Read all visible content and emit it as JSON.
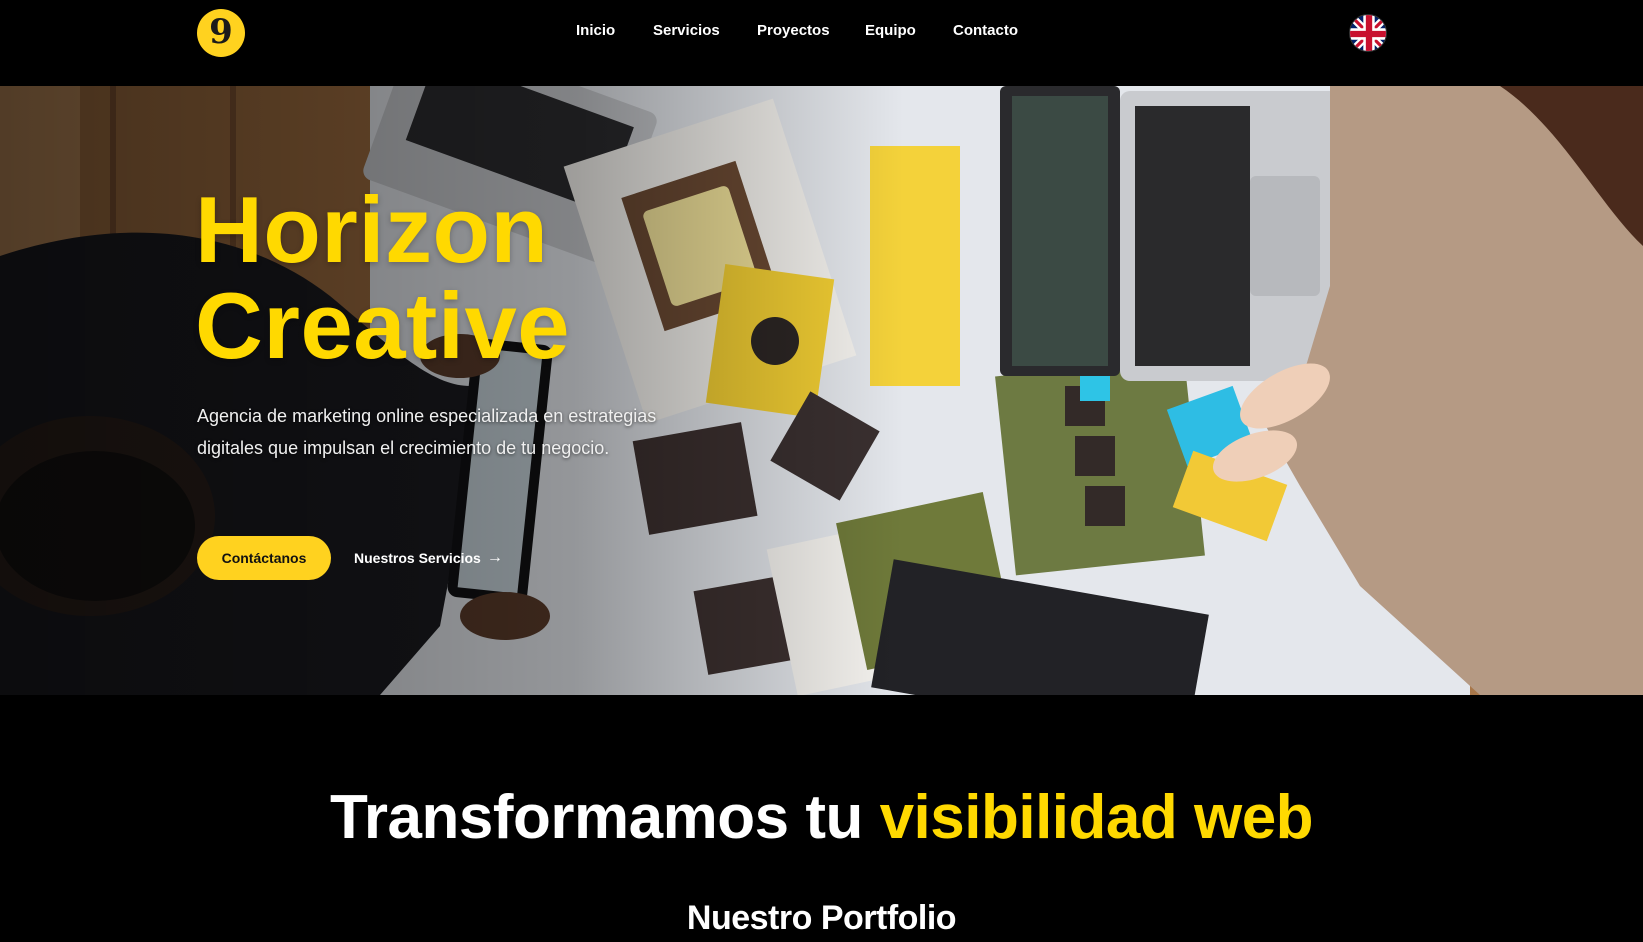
{
  "nav": {
    "logo_icon": "horizon-logo-icon",
    "items": [
      {
        "label": "Inicio"
      },
      {
        "label": "Servicios"
      },
      {
        "label": "Proyectos"
      },
      {
        "label": "Equipo"
      },
      {
        "label": "Contacto"
      }
    ],
    "language_icon": "uk-flag-icon"
  },
  "hero": {
    "title_line1": "Horizon",
    "title_line2": "Creative",
    "subtitle": "Agencia de marketing online especializada en estrategias digitales que impulsan el crecimiento de tu negocio.",
    "primary_button": "Contáctanos",
    "secondary_link": "Nuestros Servicios",
    "secondary_arrow": "→"
  },
  "section": {
    "headline_part1": "Transformamos tu ",
    "headline_accent": "visibilidad web",
    "portfolio_title": "Nuestro Portfolio"
  },
  "colors": {
    "accent": "#ffd900",
    "background": "#000000",
    "button": "#ffd21f"
  }
}
